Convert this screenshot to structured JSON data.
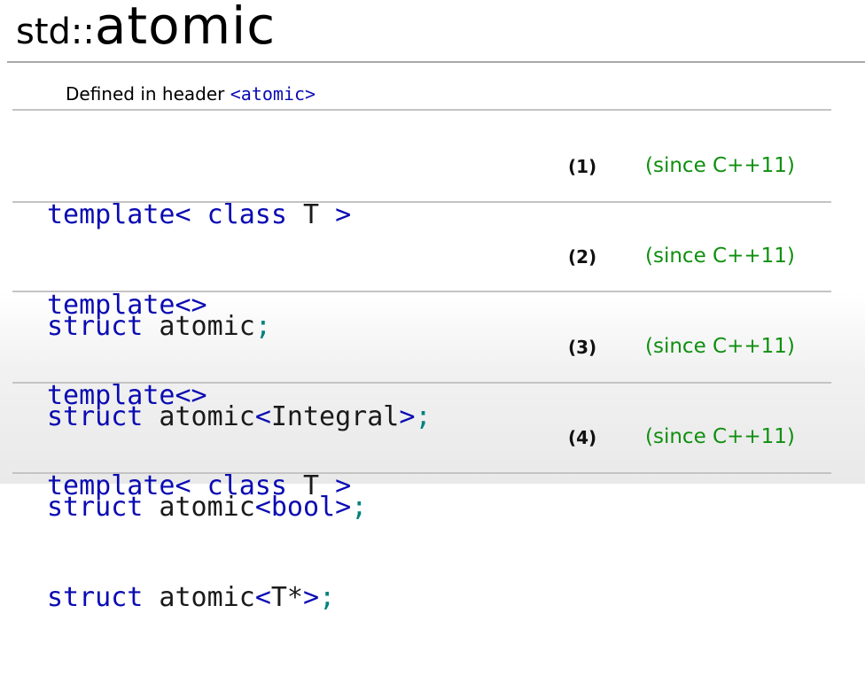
{
  "title": {
    "namespace": "std::",
    "name": "atomic"
  },
  "header": {
    "prefix": "Defined in header ",
    "name": "<atomic>"
  },
  "declarations": [
    {
      "line1": [
        {
          "t": "template<",
          "c": "kw"
        },
        {
          "t": " ",
          "c": "plain"
        },
        {
          "t": "class",
          "c": "kw"
        },
        {
          "t": " T ",
          "c": "plain"
        },
        {
          "t": ">",
          "c": "kw"
        }
      ],
      "line2": [
        {
          "t": "struct",
          "c": "kw"
        },
        {
          "t": " atomic",
          "c": "plain"
        },
        {
          "t": ";",
          "c": "semi"
        }
      ],
      "number": "(1)",
      "since": "(since C++11)"
    },
    {
      "line1": [
        {
          "t": "template<>",
          "c": "kw"
        }
      ],
      "line2": [
        {
          "t": "struct",
          "c": "kw"
        },
        {
          "t": " atomic",
          "c": "plain"
        },
        {
          "t": "<",
          "c": "punct"
        },
        {
          "t": "Integral",
          "c": "plain"
        },
        {
          "t": ">",
          "c": "punct"
        },
        {
          "t": ";",
          "c": "semi"
        }
      ],
      "number": "(2)",
      "since": "(since C++11)"
    },
    {
      "line1": [
        {
          "t": "template<>",
          "c": "kw"
        }
      ],
      "line2": [
        {
          "t": "struct",
          "c": "kw"
        },
        {
          "t": " atomic",
          "c": "plain"
        },
        {
          "t": "<",
          "c": "punct"
        },
        {
          "t": "bool",
          "c": "kw"
        },
        {
          "t": ">",
          "c": "punct"
        },
        {
          "t": ";",
          "c": "semi"
        }
      ],
      "number": "(3)",
      "since": "(since C++11)"
    },
    {
      "line1": [
        {
          "t": "template<",
          "c": "kw"
        },
        {
          "t": " ",
          "c": "plain"
        },
        {
          "t": "class",
          "c": "kw"
        },
        {
          "t": " T ",
          "c": "plain"
        },
        {
          "t": ">",
          "c": "kw"
        }
      ],
      "line2": [
        {
          "t": "struct",
          "c": "kw"
        },
        {
          "t": " atomic",
          "c": "plain"
        },
        {
          "t": "<",
          "c": "punct"
        },
        {
          "t": "T*",
          "c": "plain"
        },
        {
          "t": ">",
          "c": "punct"
        },
        {
          "t": ";",
          "c": "semi"
        }
      ],
      "number": "(4)",
      "since": "(since C++11)"
    }
  ],
  "colors": {
    "keyword": "#0b0bb3",
    "identifier": "#1a1a1a",
    "semicolon": "#008080",
    "since": "#0f8f0f",
    "rule": "#c4c4c4"
  }
}
